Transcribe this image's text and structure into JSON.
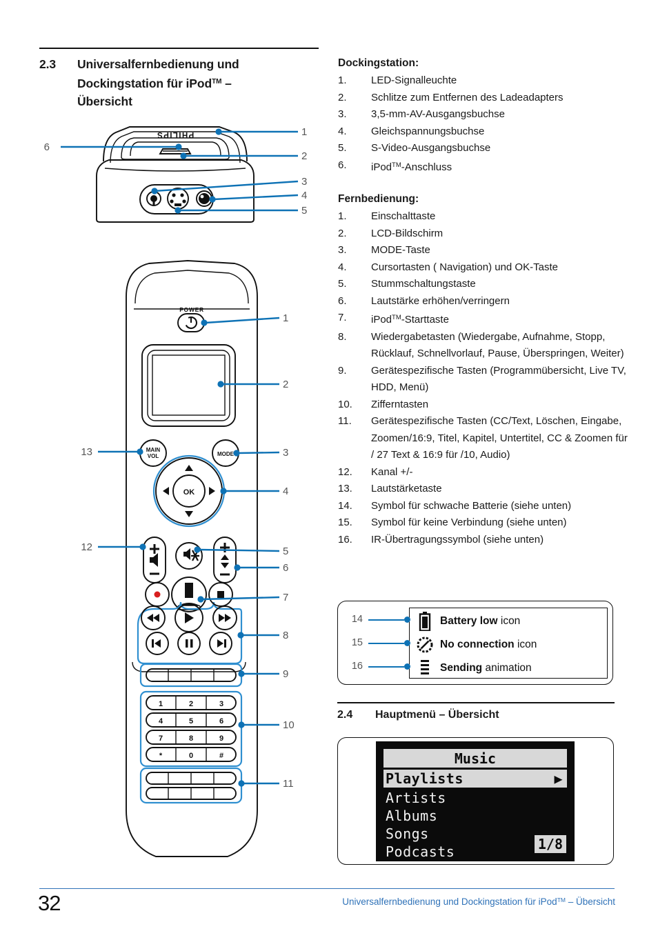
{
  "heading": {
    "number": "2.3",
    "line1": "Universalfernbedienung und",
    "line2_a": "Dockingstation für iPod",
    "line2_tm": "TM",
    "line2_b": " –",
    "line3": "Übersicht"
  },
  "dockingstation": {
    "title": "Dockingstation:",
    "items": [
      {
        "idx": "1.",
        "label": "LED-Signalleuchte"
      },
      {
        "idx": "2.",
        "label": "Schlitze zum Entfernen des Ladeadapters"
      },
      {
        "idx": "3.",
        "label": "3,5-mm-AV-Ausgangsbuchse"
      },
      {
        "idx": "4.",
        "label": "Gleichspannungsbuchse"
      },
      {
        "idx": "5.",
        "label": "S-Video-Ausgangsbuchse"
      },
      {
        "idx": "6.",
        "label_a": "iPod",
        "label_tm": "TM",
        "label_b": "-Anschluss"
      }
    ]
  },
  "fernbedienung": {
    "title": "Fernbedienung:",
    "items": [
      {
        "idx": "1.",
        "label": "Einschalttaste"
      },
      {
        "idx": "2.",
        "label": "LCD-Bildschirm"
      },
      {
        "idx": "3.",
        "label": "MODE-Taste"
      },
      {
        "idx": "4.",
        "label": "Cursortasten ( Navigation) und OK-Taste"
      },
      {
        "idx": "5.",
        "label": "Stummschaltungstaste"
      },
      {
        "idx": "6.",
        "label": "Lautstärke erhöhen/verringern"
      },
      {
        "idx": "7.",
        "label_a": "iPod",
        "label_tm": "TM",
        "label_b": "-Starttaste"
      },
      {
        "idx": "8.",
        "label": "Wiedergabetasten (Wiedergabe, Aufnahme, Stopp, Rücklauf, Schnellvorlauf, Pause, Überspringen, Weiter)"
      },
      {
        "idx": "9.",
        "label": "Gerätespezifische Tasten (Programmübersicht, Live TV, HDD, Menü)"
      },
      {
        "idx": "10.",
        "label": "Zifferntasten"
      },
      {
        "idx": "11.",
        "label": "Gerätespezifische Tasten (CC/Text, Löschen, Eingabe, Zoomen/16:9, Titel, Kapitel, Untertitel, CC & Zoomen für / 27 Text & 16:9 für /10, Audio)"
      },
      {
        "idx": "12.",
        "label": "Kanal +/-"
      },
      {
        "idx": "13.",
        "label": "Lautstärketaste"
      },
      {
        "idx": "14.",
        "label": "Symbol für schwache Batterie (siehe unten)"
      },
      {
        "idx": "15.",
        "label": "Symbol für keine Verbindung (siehe unten)"
      },
      {
        "idx": "16.",
        "label": "IR-Übertragungssymbol (siehe unten)"
      }
    ]
  },
  "legend": {
    "rows": [
      {
        "callout": "14",
        "icon": "battery-low-icon",
        "bold": "Battery low",
        "rest": " icon"
      },
      {
        "callout": "15",
        "icon": "no-connection-icon",
        "bold": "No connection",
        "rest": " icon"
      },
      {
        "callout": "16",
        "icon": "sending-animation-icon",
        "bold": "Sending",
        "rest": " animation"
      }
    ]
  },
  "section24": {
    "number": "2.4",
    "title": "Hauptmenü – Übersicht"
  },
  "lcd": {
    "title": "Music",
    "selected": "Playlists",
    "items": [
      "Artists",
      "Albums",
      "Songs",
      "Podcasts"
    ],
    "page_indicator": "1/8"
  },
  "dock_diagram": {
    "brand": "PHILIPS",
    "callouts": [
      "1",
      "2",
      "3",
      "4",
      "5",
      "6"
    ]
  },
  "remote_diagram": {
    "power_label": "POWER",
    "main_vol_label_1": "MAIN",
    "main_vol_label_2": "VOL",
    "mode_label": "MODE",
    "ok_label": "OK",
    "keypad": [
      "1",
      "2",
      "3",
      "4",
      "5",
      "6",
      "7",
      "8",
      "9",
      "*",
      "0",
      "#"
    ],
    "callouts": [
      "1",
      "2",
      "3",
      "4",
      "5",
      "6",
      "7",
      "8",
      "9",
      "10",
      "11",
      "12",
      "13"
    ]
  },
  "footer": {
    "page_number": "32",
    "text_a": "Universalfernbedienung und Dockingstation für iPod",
    "text_tm": "TM",
    "text_b": " – Übersicht"
  },
  "colors": {
    "accent_blue": "#0e72b5",
    "footer_blue": "#2f72b8",
    "callout_gray": "#555555",
    "ink": "#111111"
  }
}
